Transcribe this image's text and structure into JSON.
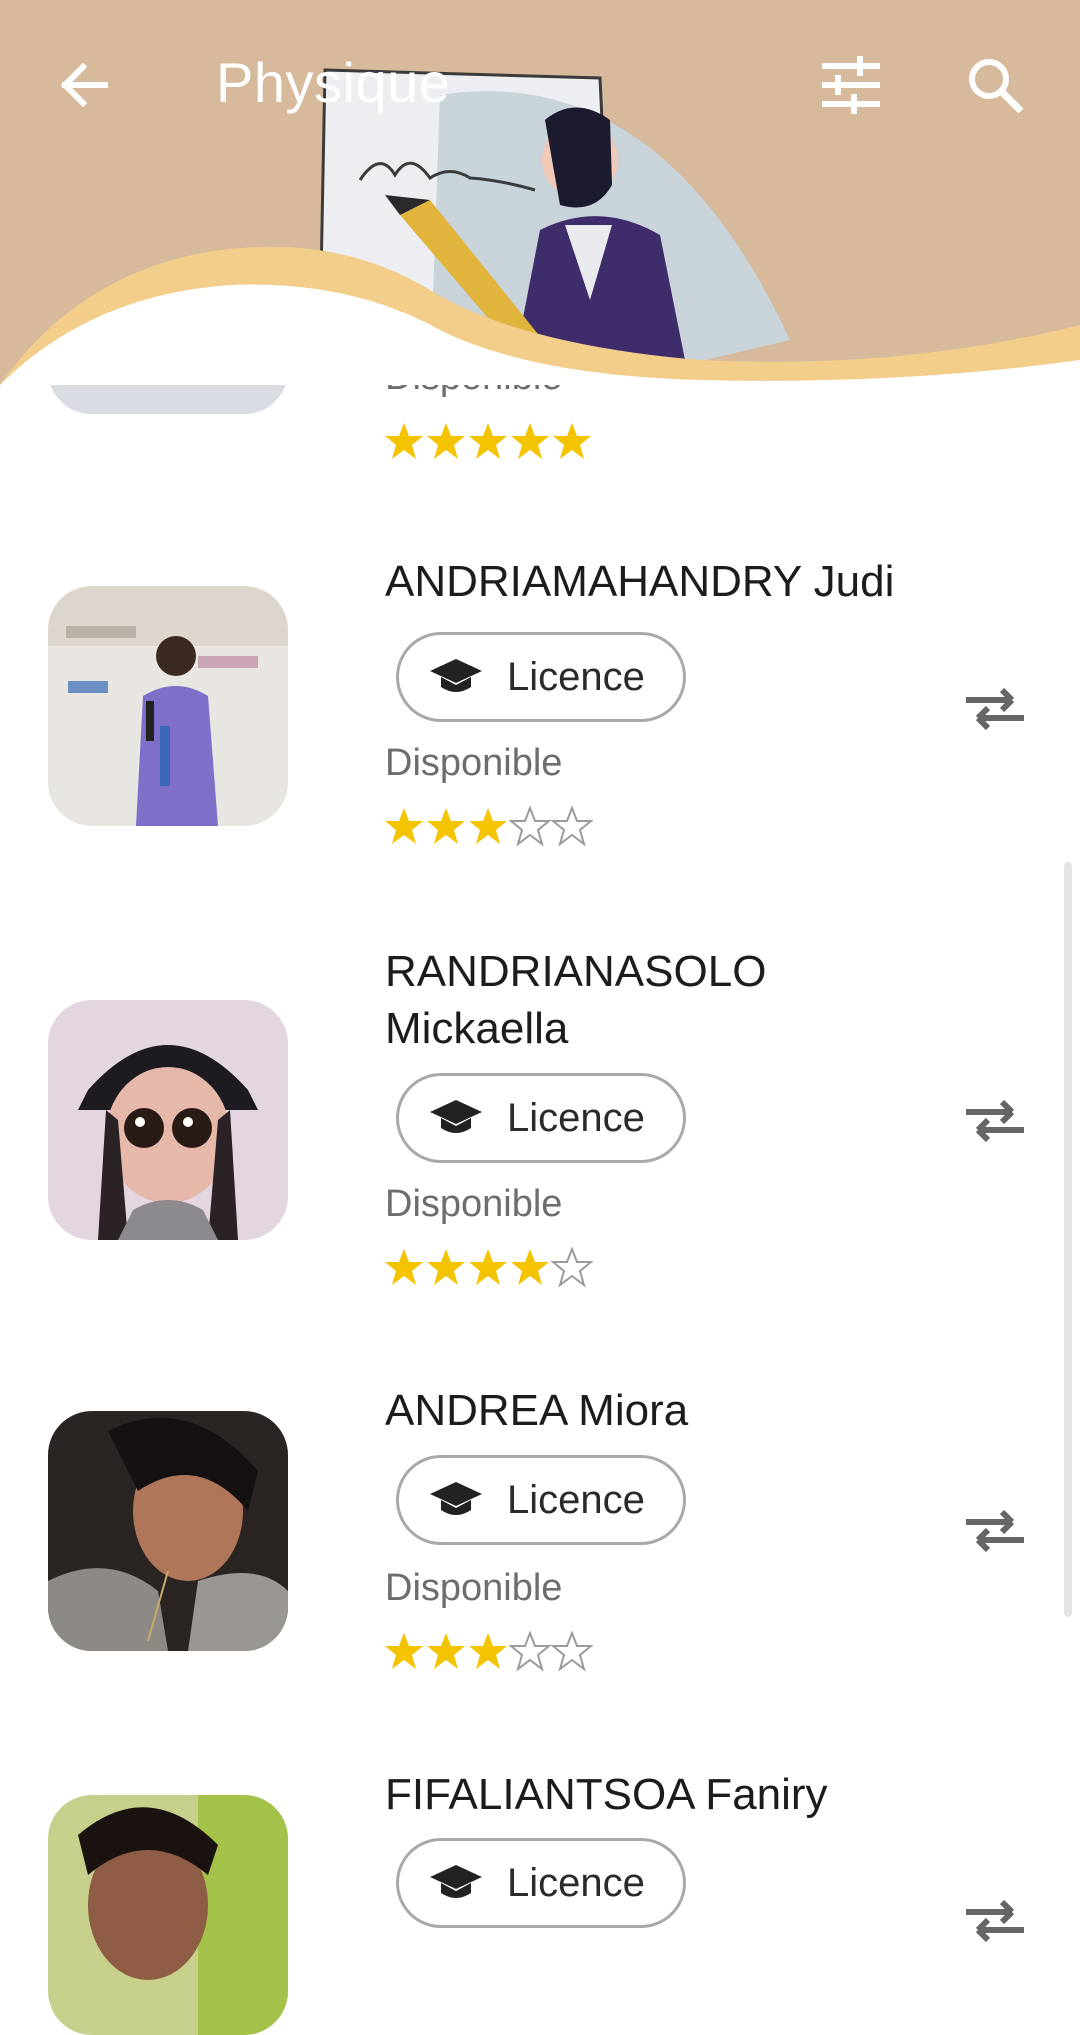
{
  "header": {
    "title": "Physique",
    "back_icon": "arrow-back-icon",
    "filter_icon": "tune-icon",
    "search_icon": "search-icon",
    "background_color": "#d7b99c"
  },
  "partial_item": {
    "status": "Disponible",
    "rating": 5,
    "max_rating": 5
  },
  "items": [
    {
      "name": "ANDRIAMAHANDRY Judi",
      "badge": "Licence",
      "status": "Disponible",
      "rating": 3,
      "max_rating": 5
    },
    {
      "name": "RANDRIANASOLO Mickaella",
      "badge": "Licence",
      "status": "Disponible",
      "rating": 4,
      "max_rating": 5
    },
    {
      "name": "ANDREA Miora",
      "badge": "Licence",
      "status": "Disponible",
      "rating": 3,
      "max_rating": 5
    },
    {
      "name": "FIFALIANTSOA Faniry",
      "badge": "Licence",
      "status": "",
      "rating": 0,
      "max_rating": 0
    }
  ],
  "colors": {
    "star_filled": "#f5c400",
    "star_empty": "#9b9b9b",
    "accent": "#d7b99c"
  }
}
